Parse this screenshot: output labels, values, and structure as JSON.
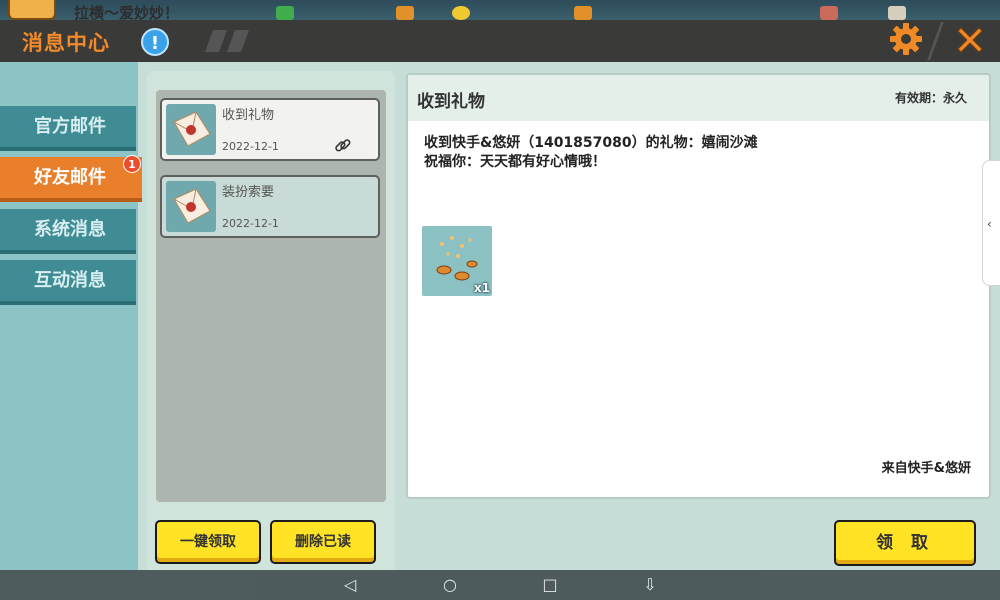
{
  "app": {
    "title": "消息中心",
    "background_top_text": "拉横～爱妙妙！"
  },
  "header": {
    "info_glyph": "!",
    "settings_icon": "gear-icon",
    "close_icon": "close-icon"
  },
  "tabs": [
    {
      "label": "官方邮件",
      "active": false
    },
    {
      "label": "好友邮件",
      "active": true,
      "badge": "1"
    },
    {
      "label": "系统消息",
      "active": false
    },
    {
      "label": "互动消息",
      "active": false
    }
  ],
  "mail_list": [
    {
      "title": "收到礼物",
      "date": "2022-12-1",
      "has_attachment": true,
      "selected": true
    },
    {
      "title": "装扮索要",
      "date": "2022-12-1",
      "has_attachment": false,
      "selected": false
    }
  ],
  "list_buttons": {
    "claim_all": "一键领取",
    "delete_read": "删除已读"
  },
  "detail": {
    "title": "收到礼物",
    "validity": "有效期：永久",
    "line1": "收到快手&悠妍（1401857080）的礼物：嬉闹沙滩",
    "line2": "祝福你：天天都有好心情哦！",
    "gift_qty": "x1",
    "sender": "来自快手&悠妍",
    "claim_button": "领 取"
  },
  "system_nav": {
    "back": "◁",
    "home": "○",
    "recents": "□",
    "extra": "⇩"
  },
  "colors": {
    "header_bg": "#3a3a38",
    "title_orange": "#f28a2a",
    "tab_teal": "#3f8c95",
    "tab_active": "#e97f2b",
    "button_yellow": "#ffe324"
  }
}
